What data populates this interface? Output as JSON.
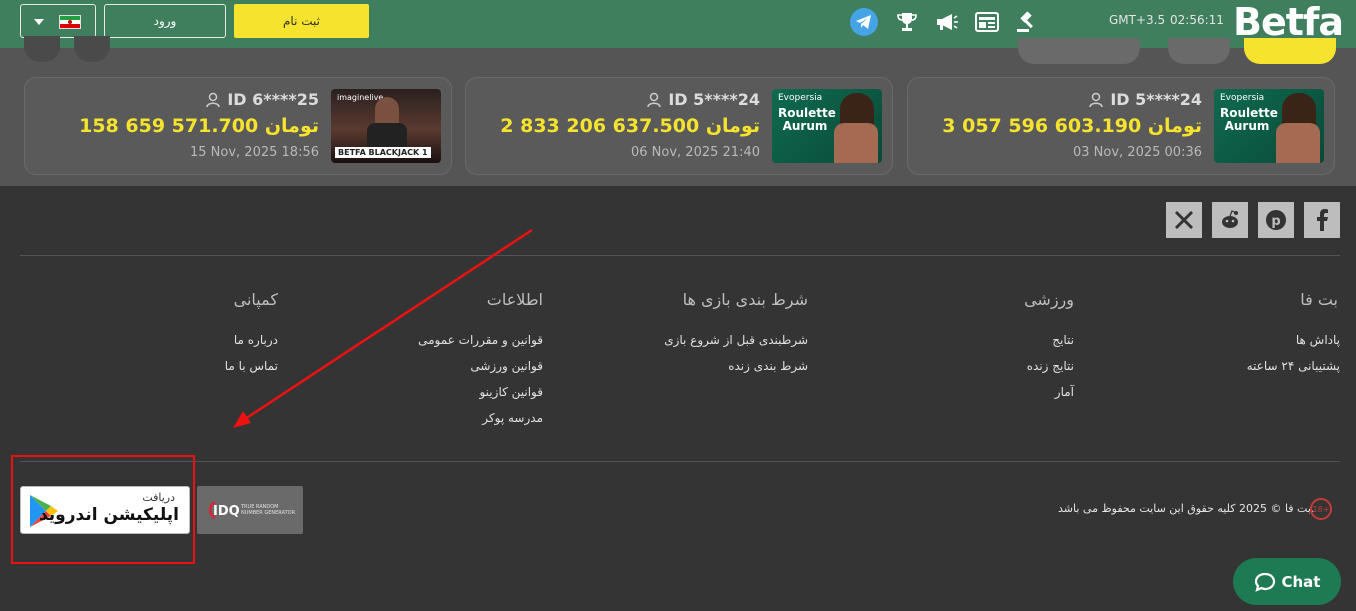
{
  "header": {
    "lang_caret": "▼",
    "login_label": "ورود",
    "signup_label": "ثبت نام",
    "timezone": "GMT+3.5",
    "time": "02:56:11",
    "logo": "Betfa",
    "icons": [
      "telegram-icon",
      "trophy-icon",
      "megaphone-icon",
      "newspaper-icon",
      "gavel-icon"
    ]
  },
  "winners": [
    {
      "uid": "ID 6****25",
      "amount": "158 659 571.700 تومان",
      "date": "15 Nov, 2025 18:56",
      "thumb_top": "imaginelive",
      "thumb_bottom": "BETFA BLACKJACK 1"
    },
    {
      "uid": "ID 5****24",
      "amount": "2 833 206 637.500 تومان",
      "date": "06 Nov, 2025 21:40",
      "thumb_top": "Evopersia",
      "thumb_bottom": "Roulette Aurum"
    },
    {
      "uid": "ID 5****24",
      "amount": "3 057 596 603.190 تومان",
      "date": "03 Nov, 2025 00:36",
      "thumb_top": "Evopersia",
      "thumb_bottom": "Roulette Aurum"
    }
  ],
  "footer": {
    "social": [
      "x-icon",
      "reddit-icon",
      "pinterest-icon",
      "facebook-icon"
    ],
    "columns": [
      {
        "title": "بت فا",
        "links": [
          "پاداش ها",
          "پشتیبانی ۲۴ ساعته"
        ]
      },
      {
        "title": "ورزشی",
        "links": [
          "نتایج",
          "نتایج زنده",
          "آمار"
        ]
      },
      {
        "title": "شرط بندی بازی ها",
        "links": [
          "شرطبندی قبل از شروع بازی",
          "شرط بندی زنده"
        ]
      },
      {
        "title": "اطلاعات",
        "links": [
          "قوانین و مقررات عمومی",
          "قوانین ورزشی",
          "قوانین کازینو",
          "مدرسه پوکر"
        ]
      },
      {
        "title": "کمپانی",
        "links": [
          "درباره ما",
          "تماس با ما"
        ]
      }
    ],
    "google_play_small": "دریافت",
    "google_play_big": "اپلیکیشن اندروید",
    "idq_label": "IDQ",
    "idq_small": "TRUE RANDOM NUMBER GENERATOR",
    "copyright": "بت فا © 2025 کلیه حقوق این سایت محفوظ می باشد.",
    "age_badge": "18+"
  },
  "chat_label": "Chat",
  "colors": {
    "header_green": "#3f7f5e",
    "accent_yellow": "#f6e32e",
    "chat_green": "#1e7a52",
    "annotation_red": "#ee1111"
  }
}
